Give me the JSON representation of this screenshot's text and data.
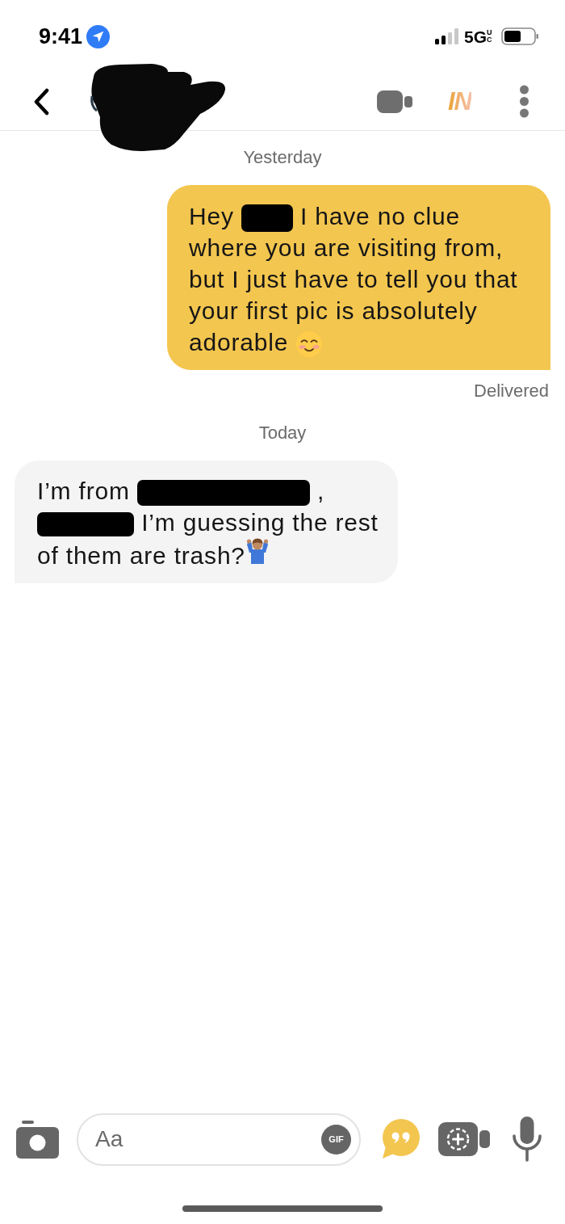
{
  "status_bar": {
    "time": "9:41",
    "network": "5G",
    "network_suffix": "UC"
  },
  "header": {
    "logo": "IN"
  },
  "conversation": [
    {
      "kind": "date",
      "text": "Yesterday"
    },
    {
      "kind": "sent",
      "parts": [
        {
          "kind": "text",
          "text": "Hey"
        },
        {
          "kind": "redaction_short"
        },
        {
          "kind": "text",
          "text": "I have no clue where you are visiting from, but I just have to tell you that your first pic is absolutely adorable"
        },
        {
          "kind": "emoji_smile"
        }
      ]
    },
    {
      "kind": "status",
      "text": "Delivered"
    },
    {
      "kind": "date",
      "text": "Today"
    },
    {
      "kind": "received",
      "parts": [
        {
          "kind": "text",
          "text": "I’m from"
        },
        {
          "kind": "redaction_long"
        },
        {
          "kind": "text",
          "text": ","
        },
        {
          "kind": "redaction_medium"
        },
        {
          "kind": "text",
          "text": "I’m guessing the rest of them are trash?"
        },
        {
          "kind": "emoji_shrug"
        }
      ]
    }
  ],
  "composer": {
    "placeholder": "Aa",
    "gif_label": "GIF"
  }
}
